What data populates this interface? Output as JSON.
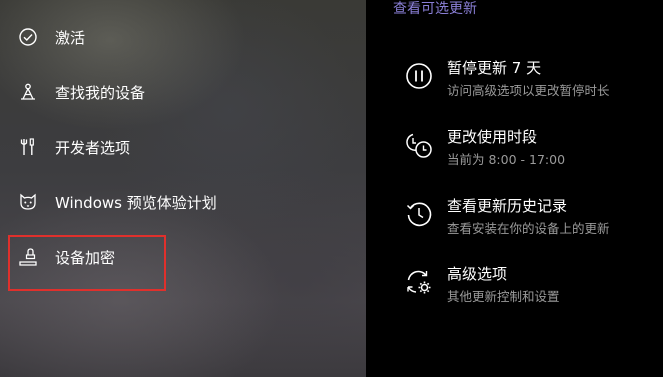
{
  "nav": {
    "items": [
      {
        "label": "激活",
        "icon": "check-circle-icon"
      },
      {
        "label": "查找我的设备",
        "icon": "find-device-icon"
      },
      {
        "label": "开发者选项",
        "icon": "developer-tools-icon"
      },
      {
        "label": "Windows 预览体验计划",
        "icon": "insider-cat-icon"
      },
      {
        "label": "设备加密",
        "icon": "device-encryption-icon"
      }
    ],
    "highlight_color": "#e0302c"
  },
  "content": {
    "top_link": "查看可选更新",
    "options": [
      {
        "title": "暂停更新 7 天",
        "subtitle": "访问高级选项以更改暂停时长",
        "icon": "pause-icon"
      },
      {
        "title": "更改使用时段",
        "subtitle": "当前为 8:00 - 17:00",
        "icon": "active-hours-icon"
      },
      {
        "title": "查看更新历史记录",
        "subtitle": "查看安装在你的设备上的更新",
        "icon": "history-icon"
      },
      {
        "title": "高级选项",
        "subtitle": "其他更新控制和设置",
        "icon": "advanced-options-icon"
      }
    ],
    "link_color": "#8a7fd6"
  }
}
